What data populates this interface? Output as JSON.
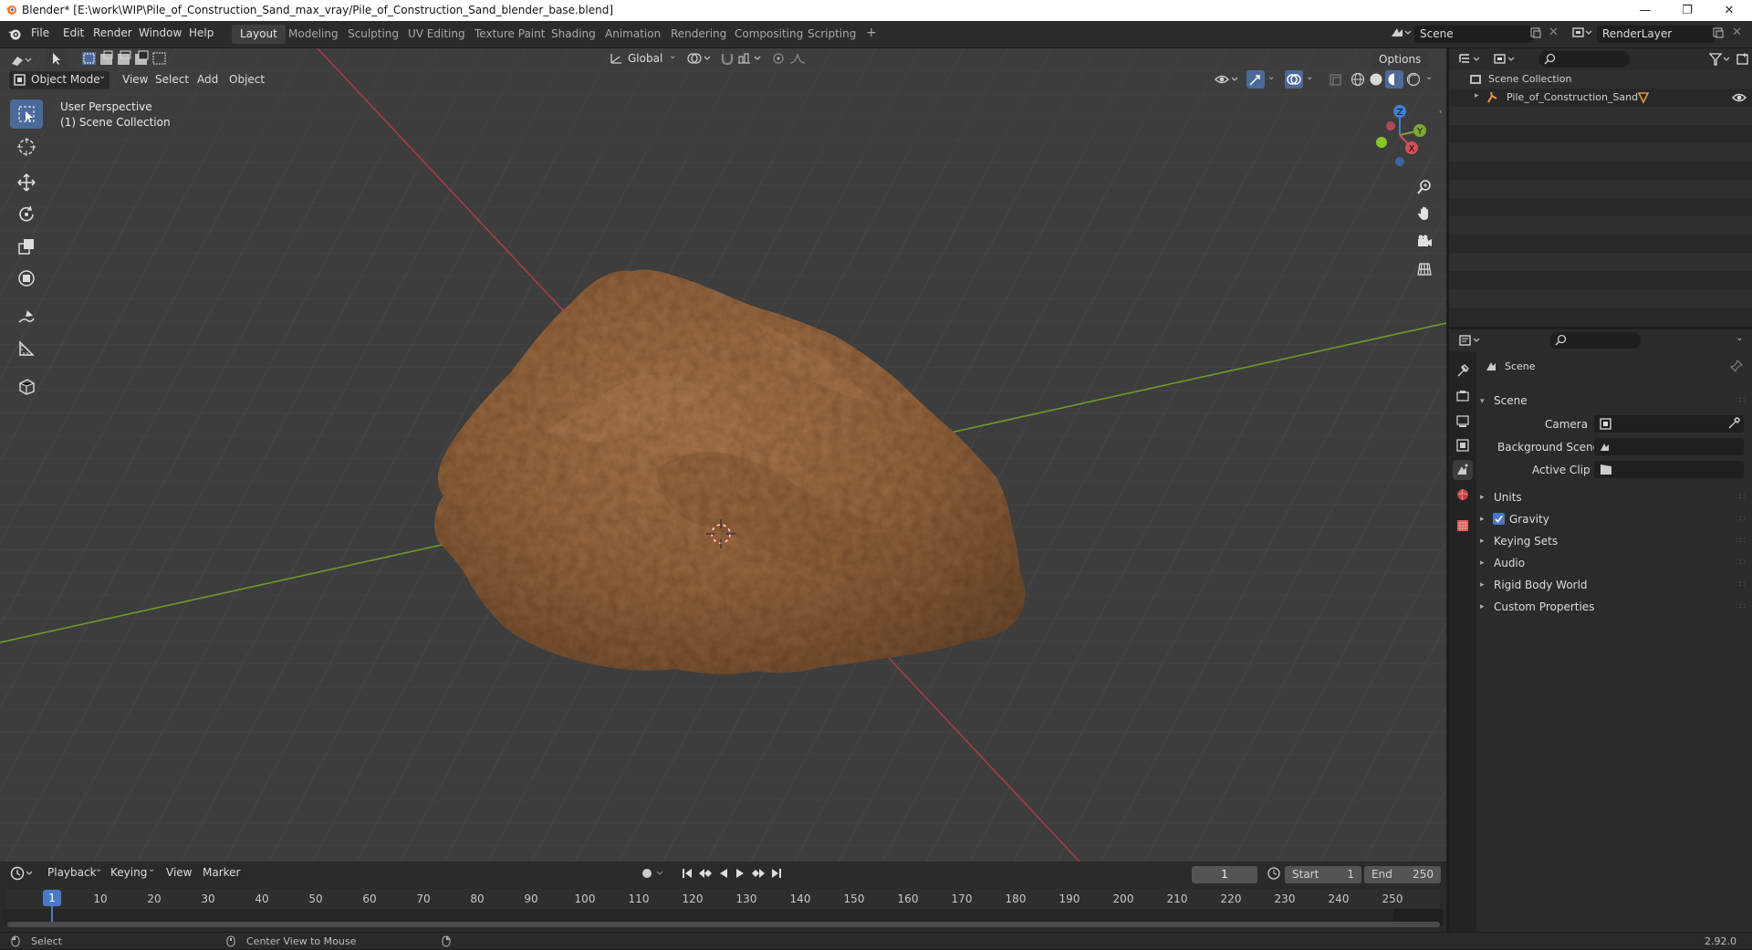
{
  "window": {
    "title": "Blender* [E:\\work\\WIP\\Pile_of_Construction_Sand_max_vray/Pile_of_Construction_Sand_blender_base.blend]",
    "minimize": "—",
    "maximize": "❐",
    "close": "✕"
  },
  "menu": [
    "File",
    "Edit",
    "Render",
    "Window",
    "Help"
  ],
  "workspaces": [
    "Layout",
    "Modeling",
    "Sculpting",
    "UV Editing",
    "Texture Paint",
    "Shading",
    "Animation",
    "Rendering",
    "Compositing",
    "Scripting"
  ],
  "add_workspace": "+",
  "scene_name": "Scene",
  "view_layer": "RenderLayer",
  "viewport_header": {
    "transform_orientation": "Global",
    "options": "Options",
    "mode": "Object Mode",
    "menus": [
      "View",
      "Select",
      "Add",
      "Object"
    ]
  },
  "viewport": {
    "perspective": "User Perspective",
    "collection": "(1) Scene Collection",
    "gizmo": {
      "z": "Z",
      "y": "Y",
      "x": "X"
    }
  },
  "outliner": {
    "root": "Scene Collection",
    "items": [
      {
        "label": "Pile_of_Construction_Sand"
      }
    ]
  },
  "properties": {
    "context": "Scene",
    "panel": "Scene",
    "fields": [
      {
        "label": "Camera"
      },
      {
        "label": "Background Scene"
      },
      {
        "label": "Active Clip"
      }
    ],
    "sections": [
      {
        "label": "Units",
        "checkbox": false
      },
      {
        "label": "Gravity",
        "checkbox": true
      },
      {
        "label": "Keying Sets",
        "checkbox": false
      },
      {
        "label": "Audio",
        "checkbox": false
      },
      {
        "label": "Rigid Body World",
        "checkbox": false
      },
      {
        "label": "Custom Properties",
        "checkbox": false
      }
    ]
  },
  "timeline": {
    "menus": [
      "Playback",
      "Keying",
      "View",
      "Marker"
    ],
    "current_frame": "1",
    "start_label": "Start",
    "start": "1",
    "end_label": "End",
    "end": "250",
    "ruler": [
      "10",
      "20",
      "30",
      "40",
      "50",
      "60",
      "70",
      "80",
      "90",
      "100",
      "110",
      "120",
      "130",
      "140",
      "150",
      "160",
      "170",
      "180",
      "190",
      "200",
      "210",
      "220",
      "230",
      "240",
      "250"
    ],
    "playhead": "1"
  },
  "status": {
    "left": "Select",
    "middle": "Center View to Mouse",
    "version": "2.92.0"
  },
  "colors": {
    "accent": "#4b6a9a",
    "x_axis": "#a73c47",
    "y_axis": "#6c9a2a",
    "sand": "#9b6a44"
  }
}
